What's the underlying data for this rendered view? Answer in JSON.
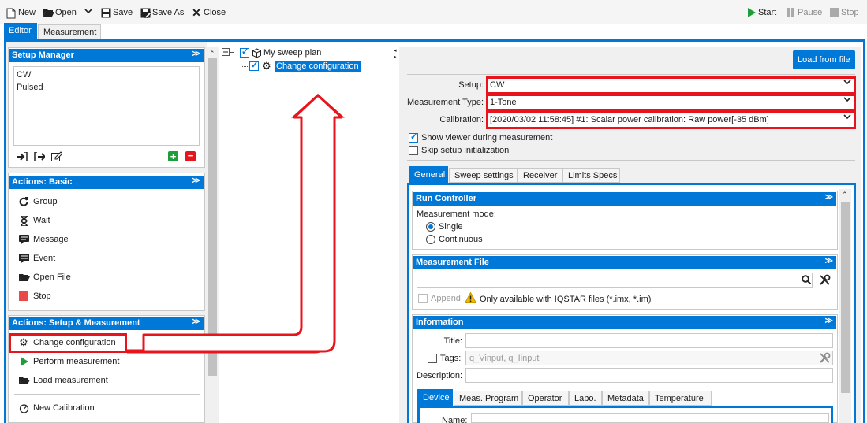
{
  "toolbar": {
    "new": "New",
    "open": "Open",
    "save": "Save",
    "save_as": "Save As",
    "close": "Close",
    "start": "Start",
    "pause": "Pause",
    "stop": "Stop"
  },
  "top_tabs": {
    "editor": "Editor",
    "measurement": "Measurement"
  },
  "setup_manager": {
    "title": "Setup Manager",
    "items": [
      "CW",
      "Pulsed"
    ]
  },
  "actions_basic": {
    "title": "Actions: Basic",
    "items": [
      {
        "label": "Group",
        "icon": "refresh-icon"
      },
      {
        "label": "Wait",
        "icon": "hourglass-icon"
      },
      {
        "label": "Message",
        "icon": "message-icon"
      },
      {
        "label": "Event",
        "icon": "event-icon"
      },
      {
        "label": "Open File",
        "icon": "folder-open-icon"
      },
      {
        "label": "Stop",
        "icon": "stop-icon"
      }
    ]
  },
  "actions_setup": {
    "title": "Actions: Setup & Measurement",
    "items": [
      {
        "label": "Change configuration",
        "icon": "gear-icon"
      },
      {
        "label": "Perform measurement",
        "icon": "play-icon"
      },
      {
        "label": "Load measurement",
        "icon": "folder-open-icon"
      },
      {
        "label": "New Calibration",
        "icon": "gauge-icon"
      }
    ]
  },
  "tree": {
    "root": "My sweep plan",
    "child": "Change configuration"
  },
  "right": {
    "load_button": "Load from file",
    "setup_label": "Setup:",
    "setup_value": "CW",
    "type_label": "Measurement Type:",
    "type_value": "1-Tone",
    "calib_label": "Calibration:",
    "calib_value": "[2020/03/02 11:58:45] #1: Scalar power calibration: Raw power[-35 dBm]",
    "show_viewer": "Show viewer during measurement",
    "skip_init": "Skip setup initialization",
    "tabs": [
      "General",
      "Sweep settings",
      "Receiver",
      "Limits Specs"
    ],
    "run_controller": {
      "title": "Run Controller",
      "mode_label": "Measurement mode:",
      "single": "Single",
      "continuous": "Continuous"
    },
    "measurement_file": {
      "title": "Measurement File",
      "append": "Append",
      "note": "Only available with IQSTAR files (*.imx, *.im)"
    },
    "information": {
      "title": "Information",
      "title_label": "Title:",
      "tags_label": "Tags:",
      "tags_placeholder": "q_Vinput, q_Iinput",
      "description_label": "Description:",
      "tabs": [
        "Device",
        "Meas. Program",
        "Operator",
        "Labo.",
        "Metadata",
        "Temperature"
      ],
      "name_label": "Name:"
    }
  },
  "colors": {
    "accent": "#0078d7",
    "highlight": "#e8141b",
    "start_green": "#1e9e3a"
  }
}
